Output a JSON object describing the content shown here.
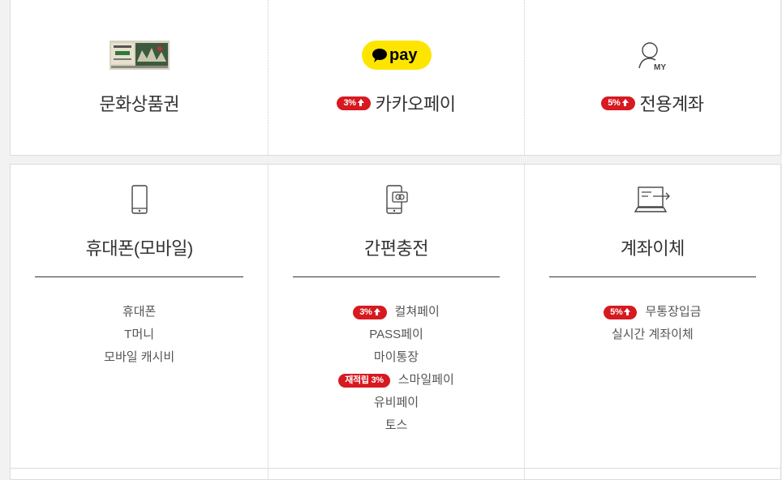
{
  "methods_top": [
    {
      "title": "문화상품권",
      "icon": "culture-gift-card-icon"
    },
    {
      "title": "카카오페이",
      "badge": "3%",
      "icon": "kakaopay-logo-icon",
      "logo_text": "pay"
    },
    {
      "title": "전용계좌",
      "badge": "5%",
      "icon": "my-account-icon",
      "logo_text": "MY"
    }
  ],
  "methods_bottom": [
    {
      "title": "휴대폰(모바일)",
      "icon": "mobile-phone-icon",
      "items": [
        {
          "label": "휴대폰"
        },
        {
          "label": "T머니"
        },
        {
          "label": "모바일 캐시비"
        }
      ]
    },
    {
      "title": "간편충전",
      "icon": "easy-charge-phone-icon",
      "items": [
        {
          "label": "컬쳐페이",
          "badge": "3%"
        },
        {
          "label": "PASS페이"
        },
        {
          "label": "마이통장"
        },
        {
          "label": "스마일페이",
          "badge": "재적립 3%"
        },
        {
          "label": "유비페이"
        },
        {
          "label": "토스"
        }
      ]
    },
    {
      "title": "계좌이체",
      "icon": "bank-transfer-laptop-icon",
      "items": [
        {
          "label": "무통장입금",
          "badge": "5%"
        },
        {
          "label": "실시간 계좌이체"
        }
      ]
    }
  ],
  "colors": {
    "badge": "#d71920",
    "kakao_yellow": "#fee500"
  }
}
